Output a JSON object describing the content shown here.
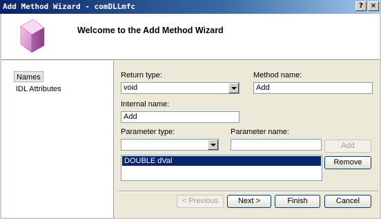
{
  "window": {
    "title": "Add Method Wizard - comDLLmfc",
    "help_btn": "?",
    "close_btn": "×"
  },
  "header": {
    "welcome": "Welcome to the Add Method Wizard"
  },
  "sidebar": {
    "items": [
      {
        "label": "Names",
        "selected": true
      },
      {
        "label": "IDL Attributes",
        "selected": false
      }
    ]
  },
  "form": {
    "return_type": {
      "label": "Return type:",
      "value": "void"
    },
    "method_name": {
      "label": "Method name:",
      "value": "Add"
    },
    "internal_name": {
      "label": "Internal name:",
      "value": "Add"
    },
    "parameter_type": {
      "label": "Parameter type:",
      "value": ""
    },
    "parameter_name": {
      "label": "Parameter name:",
      "value": ""
    },
    "add_button": "Add",
    "remove_button": "Remove",
    "parameters": [
      "DOUBLE dVal"
    ]
  },
  "footer": {
    "previous": "< Previous",
    "next": "Next >",
    "finish": "Finish",
    "cancel": "Cancel"
  }
}
